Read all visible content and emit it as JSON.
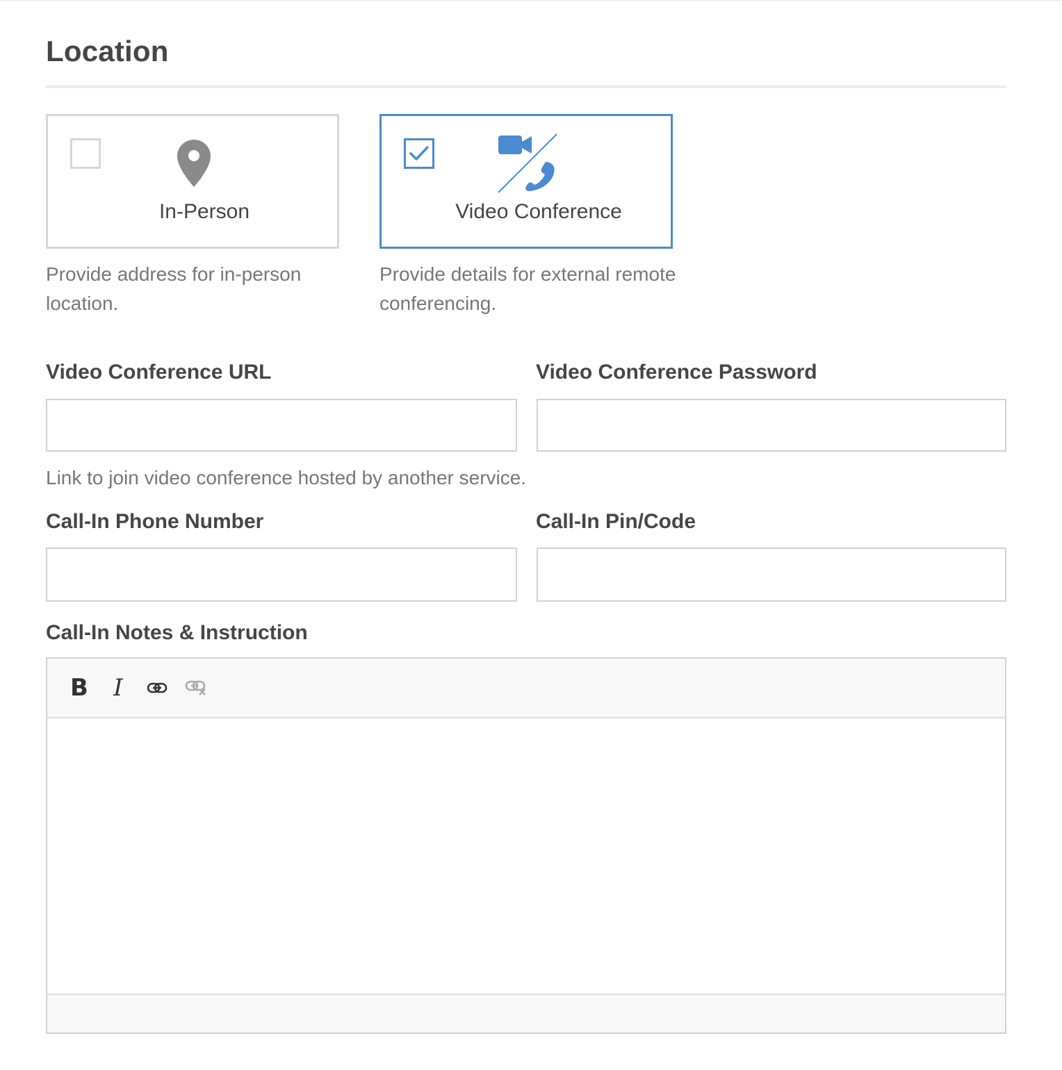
{
  "section": {
    "title": "Location"
  },
  "options": {
    "in_person": {
      "label": "In-Person",
      "description": "Provide address for in-person location.",
      "checked": false,
      "icon": "map-pin-icon"
    },
    "video_conference": {
      "label": "Video Conference",
      "description": "Provide details for external remote conferencing.",
      "checked": true,
      "icon": "video-phone-icon"
    }
  },
  "fields": {
    "video_url": {
      "label": "Video Conference URL",
      "value": "",
      "placeholder": "",
      "help": "Link to join video conference hosted by another service."
    },
    "video_password": {
      "label": "Video Conference Password",
      "value": "",
      "placeholder": ""
    },
    "phone_number": {
      "label": "Call-In Phone Number",
      "value": "",
      "placeholder": ""
    },
    "pin_code": {
      "label": "Call-In Pin/Code",
      "value": "",
      "placeholder": ""
    },
    "notes": {
      "label": "Call-In Notes & Instruction",
      "value": ""
    }
  },
  "editor": {
    "toolbar": {
      "bold_label": "B",
      "italic_label": "I",
      "link_icon": "link-icon",
      "unlink_icon": "unlink-icon"
    }
  },
  "colors": {
    "accent": "#4a8bd1",
    "border": "#d7d7d7",
    "text": "#464646",
    "muted": "#777777"
  }
}
